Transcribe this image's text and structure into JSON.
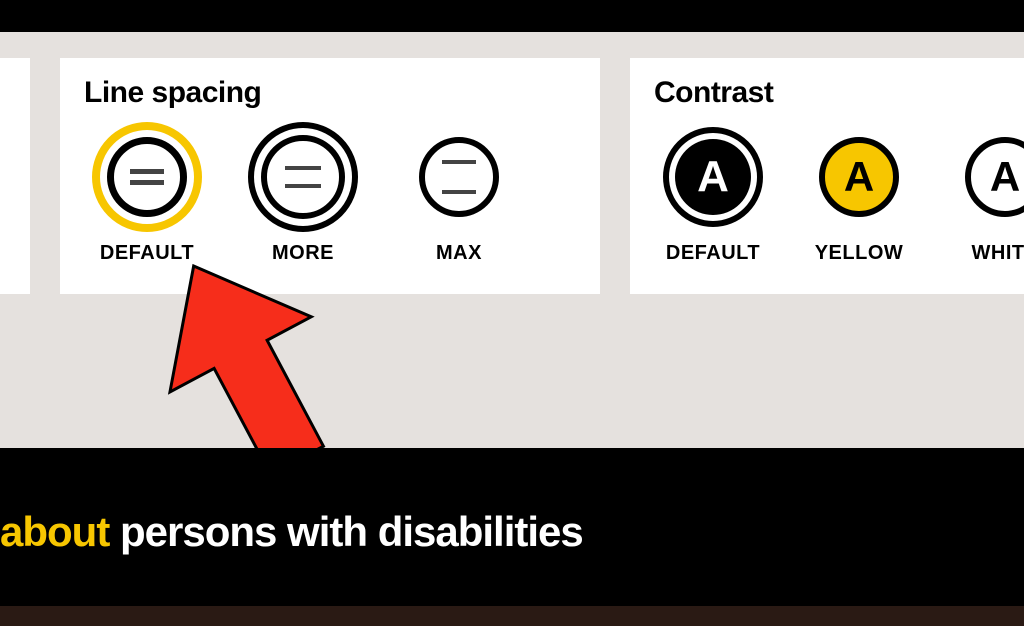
{
  "lineSpacing": {
    "title": "Line spacing",
    "options": [
      {
        "label": "DEFAULT",
        "glyph": "="
      },
      {
        "label": "MORE",
        "glyph": "="
      },
      {
        "label": "MAX",
        "glyph": "="
      }
    ]
  },
  "contrast": {
    "title": "Contrast",
    "options": [
      {
        "label": "DEFAULT",
        "glyph": "A"
      },
      {
        "label": "YELLOW",
        "glyph": "A"
      },
      {
        "label": "WHITE",
        "glyph": "A"
      }
    ]
  },
  "bottom": {
    "yellow": "about",
    "white": "persons with disabilities"
  }
}
